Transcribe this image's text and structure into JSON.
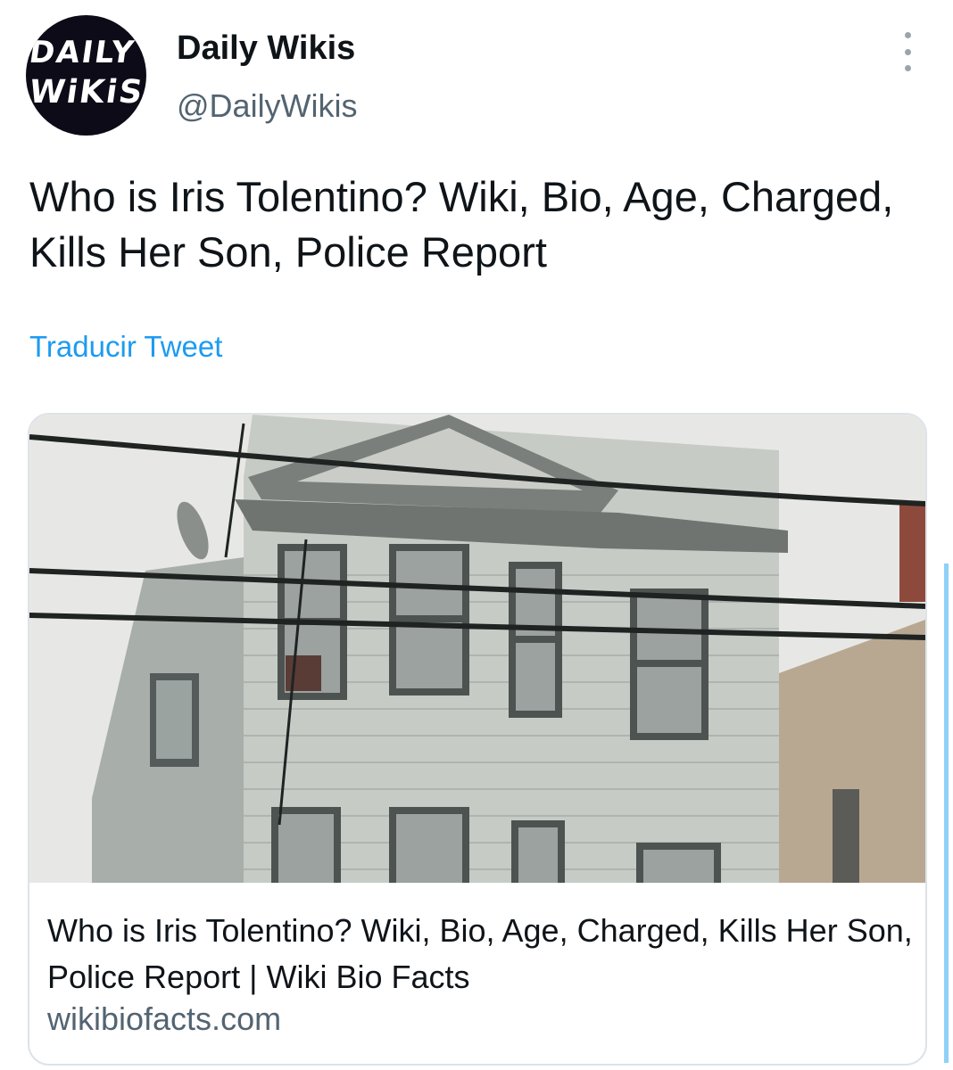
{
  "account": {
    "name": "Daily Wikis",
    "handle": "@DailyWikis",
    "avatar_logo_line1": "DAILY",
    "avatar_logo_line2": "WiKiS"
  },
  "more_icon": "more-vertical-icon",
  "tweet": {
    "text": "Who is Iris Tolentino? Wiki, Bio, Age, Charged, Kills Her Son, Police Report",
    "translate_label": "Traducir Tweet"
  },
  "card": {
    "title": "Who is Iris Tolentino? Wiki, Bio, Age, Charged, Kills Her Son, Police Report | Wiki Bio Facts",
    "domain": "wikibiofacts.com"
  },
  "colors": {
    "link": "#1d9bf0",
    "secondary_text": "#536471",
    "primary_text": "#0f1419"
  }
}
